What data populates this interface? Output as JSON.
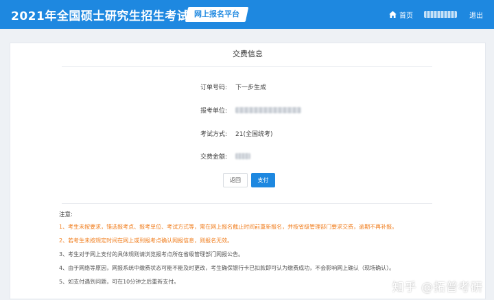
{
  "header": {
    "site_title": "2021年全国硕士研究生招生考试",
    "platform_tag": "网上报名平台",
    "nav_home": "首页",
    "nav_logout": "退出"
  },
  "card": {
    "title": "交费信息",
    "fields": [
      {
        "label": "订单号码:",
        "value": "下一步生成"
      },
      {
        "label": "报考单位:",
        "value": ""
      },
      {
        "label": "考试方式:",
        "value": "21(全国统考)"
      },
      {
        "label": "交费金额:",
        "value": ""
      }
    ],
    "back_label": "返回",
    "pay_label": "支付"
  },
  "notes": {
    "title": "注意:",
    "items": [
      {
        "text": "1、考生未按要求，错选报考点、报考单位、考试方式等，需在网上报名截止时间前重新报名，并按省级管理部门要求交费，逾期不再补报。",
        "color": "orange"
      },
      {
        "text": "2、若考生未按规定时间在网上或到报考点确认网报信息，则报名无效。",
        "color": "orange"
      },
      {
        "text": "3、考生对于网上支付的具体规则请浏览报考点所在省级管理部门网报公告。",
        "color": "gray"
      },
      {
        "text": "4、由于网络等原因，网报系统中缴费状态可能不能及时更改，考生确保银行卡已扣款即可认为缴费成功，不会影响网上确认（现场确认）。",
        "color": "gray"
      },
      {
        "text": "5、如支付遇到问题，可在10分钟之后重新支付。",
        "color": "gray"
      }
    ]
  },
  "watermark": "知乎 @拓普考研",
  "colors": {
    "primary": "#1e88e0",
    "warning": "#f07d1d"
  }
}
